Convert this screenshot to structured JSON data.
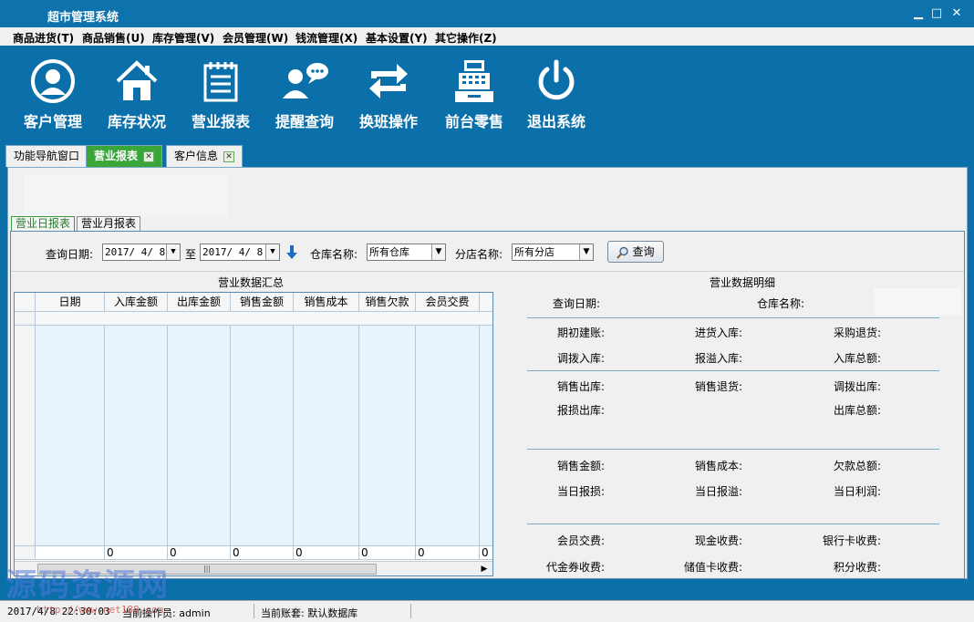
{
  "window": {
    "title": "超市管理系统",
    "min": "▁",
    "max": "□",
    "close": "✕"
  },
  "menu": [
    "商品进货(T)",
    "商品销售(U)",
    "库存管理(V)",
    "会员管理(W)",
    "钱流管理(X)",
    "基本设置(Y)",
    "其它操作(Z)"
  ],
  "toolbar": [
    {
      "label": "客户管理",
      "icon": "user-circle-icon"
    },
    {
      "label": "库存状况",
      "icon": "house-icon"
    },
    {
      "label": "营业报表",
      "icon": "notepad-icon"
    },
    {
      "label": "提醒查询",
      "icon": "chat-user-icon"
    },
    {
      "label": "换班操作",
      "icon": "swap-arrows-icon"
    },
    {
      "label": "前台零售",
      "icon": "cash-register-icon"
    },
    {
      "label": "退出系统",
      "icon": "power-icon"
    }
  ],
  "tabs": [
    {
      "label": "功能导航窗口",
      "closable": false,
      "active": false
    },
    {
      "label": "营业报表",
      "closable": true,
      "active": true
    },
    {
      "label": "客户信息",
      "closable": true,
      "active": false
    }
  ],
  "subtabs": [
    "营业日报表",
    "营业月报表"
  ],
  "query": {
    "date_label": "查询日期:",
    "date_from": "2017/ 4/ 8",
    "to_label": "至",
    "date_to": "2017/ 4/ 8",
    "warehouse_label": "仓库名称:",
    "warehouse_value": "所有仓库",
    "branch_label": "分店名称:",
    "branch_value": "所有分店",
    "query_button": "查询"
  },
  "summary": {
    "title": "营业数据汇总",
    "columns": [
      "日期",
      "入库金额",
      "出库金额",
      "销售金额",
      "销售成本",
      "销售欠款",
      "会员交费"
    ],
    "totals": [
      "0",
      "0",
      "0",
      "0",
      "0",
      "0",
      "0"
    ]
  },
  "detail": {
    "title": "营业数据明细",
    "query_date_label": "查询日期:",
    "warehouse_label": "仓库名称:",
    "group1": [
      "期初建账:",
      "进货入库:",
      "采购退货:",
      "调拨入库:",
      "报溢入库:",
      "入库总额:"
    ],
    "group2": [
      "销售出库:",
      "销售退货:",
      "调拨出库:",
      "报损出库:",
      "出库总额:"
    ],
    "group3": [
      "销售金额:",
      "销售成本:",
      "欠款总额:",
      "当日报损:",
      "当日报溢:",
      "当日利润:"
    ],
    "group4": [
      "会员交费:",
      "现金收费:",
      "银行卡收费:",
      "代金券收费:",
      "储值卡收费:",
      "积分收费:"
    ]
  },
  "status": {
    "datetime": "2017/4/8 22:30:03",
    "operator": "当前操作员: admin",
    "account": "当前账套: 默认数据库"
  },
  "watermark": {
    "text": "源码资源网",
    "url": "http://www.net188.com"
  }
}
